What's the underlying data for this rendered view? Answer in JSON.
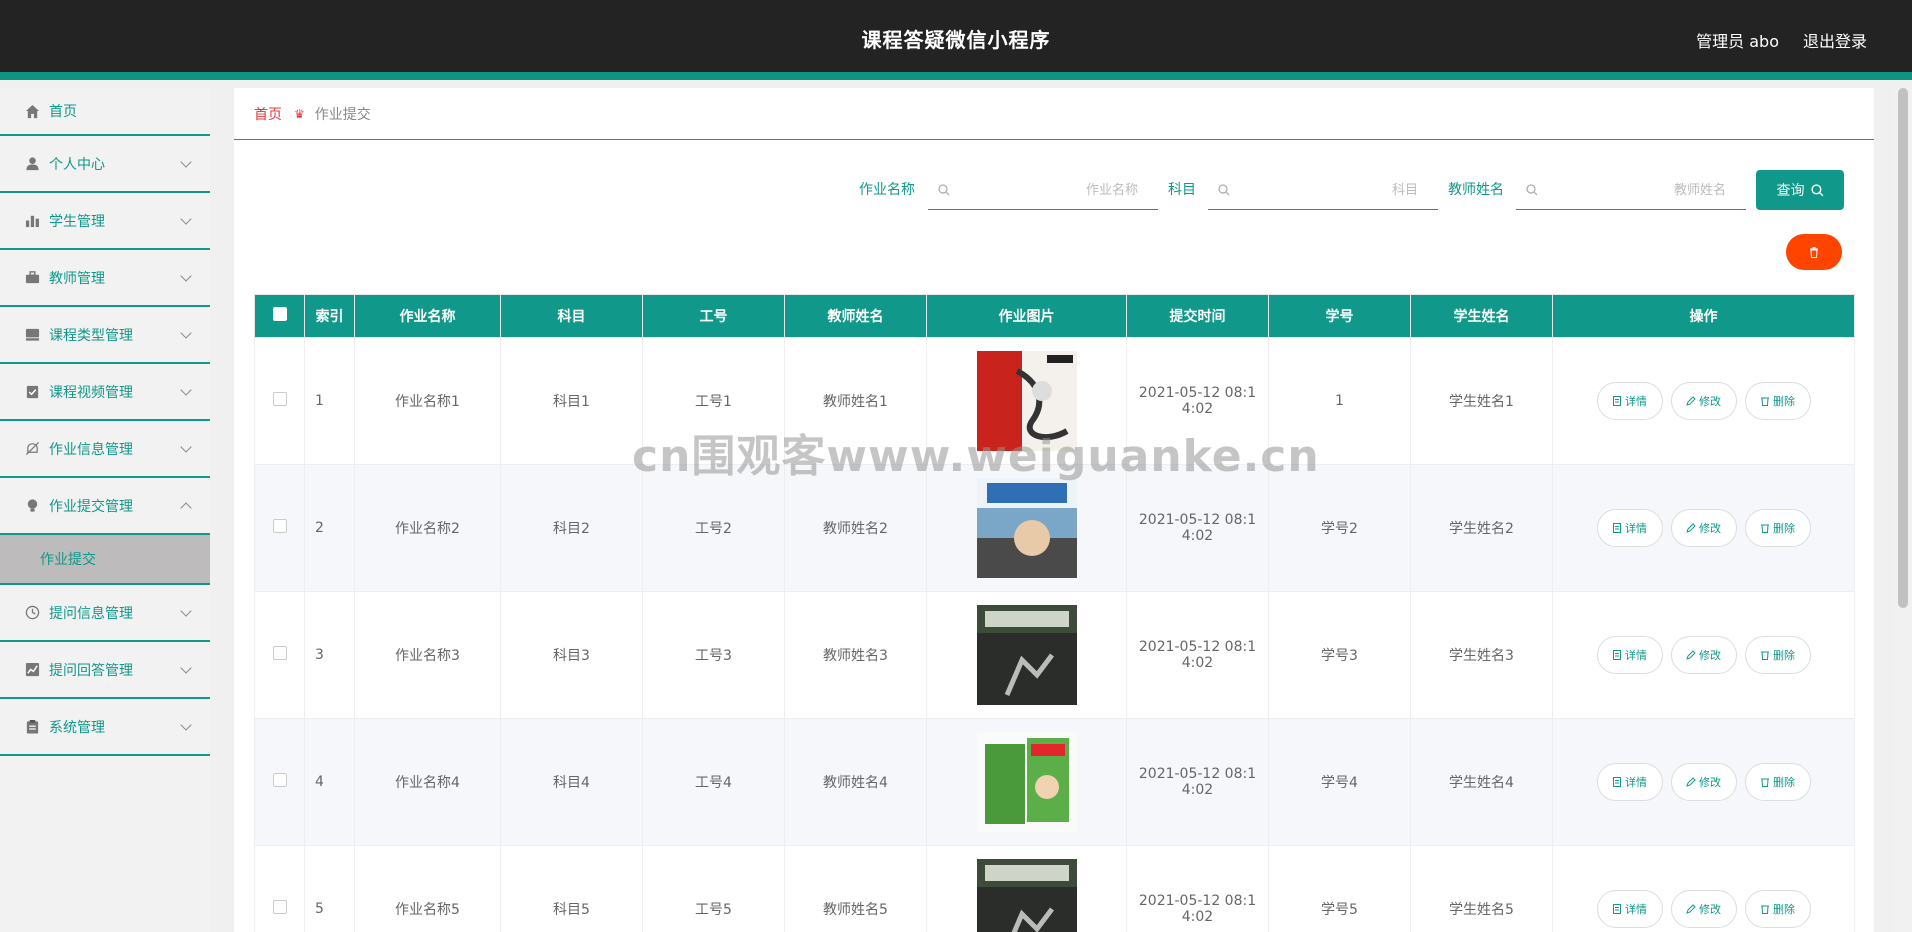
{
  "header": {
    "title": "课程答疑微信小程序",
    "user": "管理员 abo",
    "logout": "退出登录"
  },
  "sidebar": {
    "items": [
      {
        "label": "首页",
        "icon": "home-icon"
      },
      {
        "label": "个人中心",
        "icon": "user-icon"
      },
      {
        "label": "学生管理",
        "icon": "bar-chart-icon"
      },
      {
        "label": "教师管理",
        "icon": "briefcase-icon"
      },
      {
        "label": "课程类型管理",
        "icon": "drive-icon"
      },
      {
        "label": "课程视频管理",
        "icon": "clipboard-check-icon"
      },
      {
        "label": "作业信息管理",
        "icon": "bell-off-icon"
      },
      {
        "label": "作业提交管理",
        "icon": "bulb-icon"
      },
      {
        "label": "提问信息管理",
        "icon": "clock-icon"
      },
      {
        "label": "提问回答管理",
        "icon": "line-chart-icon"
      },
      {
        "label": "系统管理",
        "icon": "clipboard-icon"
      }
    ],
    "submenu": {
      "label": "作业提交"
    }
  },
  "breadcrumb": {
    "home": "首页",
    "current": "作业提交"
  },
  "search": {
    "fields": [
      {
        "label": "作业名称",
        "placeholder": "作业名称"
      },
      {
        "label": "科目",
        "placeholder": "科目"
      },
      {
        "label": "教师姓名",
        "placeholder": "教师姓名"
      }
    ],
    "button": "查询"
  },
  "table": {
    "headers": [
      "索引",
      "作业名称",
      "科目",
      "工号",
      "教师姓名",
      "作业图片",
      "提交时间",
      "学号",
      "学生姓名",
      "操作"
    ],
    "rows": [
      {
        "index": "1",
        "name": "作业名称1",
        "subject": "科目1",
        "emp_no": "工号1",
        "teacher": "教师姓名1",
        "time_l1": "2021-05-12 08:1",
        "time_l2": "4:02",
        "student_no": "1",
        "student": "学生姓名1"
      },
      {
        "index": "2",
        "name": "作业名称2",
        "subject": "科目2",
        "emp_no": "工号2",
        "teacher": "教师姓名2",
        "time_l1": "2021-05-12 08:1",
        "time_l2": "4:02",
        "student_no": "学号2",
        "student": "学生姓名2"
      },
      {
        "index": "3",
        "name": "作业名称3",
        "subject": "科目3",
        "emp_no": "工号3",
        "teacher": "教师姓名3",
        "time_l1": "2021-05-12 08:1",
        "time_l2": "4:02",
        "student_no": "学号3",
        "student": "学生姓名3"
      },
      {
        "index": "4",
        "name": "作业名称4",
        "subject": "科目4",
        "emp_no": "工号4",
        "teacher": "教师姓名4",
        "time_l1": "2021-05-12 08:1",
        "time_l2": "4:02",
        "student_no": "学号4",
        "student": "学生姓名4"
      },
      {
        "index": "5",
        "name": "作业名称5",
        "subject": "科目5",
        "emp_no": "工号5",
        "teacher": "教师姓名5",
        "time_l1": "2021-05-12 08:1",
        "time_l2": "4:02",
        "student_no": "学号5",
        "student": "学生姓名5"
      }
    ],
    "actions": {
      "detail": "详情",
      "edit": "修改",
      "delete": "删除"
    }
  },
  "watermark": "cn围观客www.weiguanke.cn",
  "colors": {
    "accent": "#10988a",
    "header_bg": "#232323",
    "danger": "#ff4400",
    "breadcrumb_home": "#e4393c"
  }
}
